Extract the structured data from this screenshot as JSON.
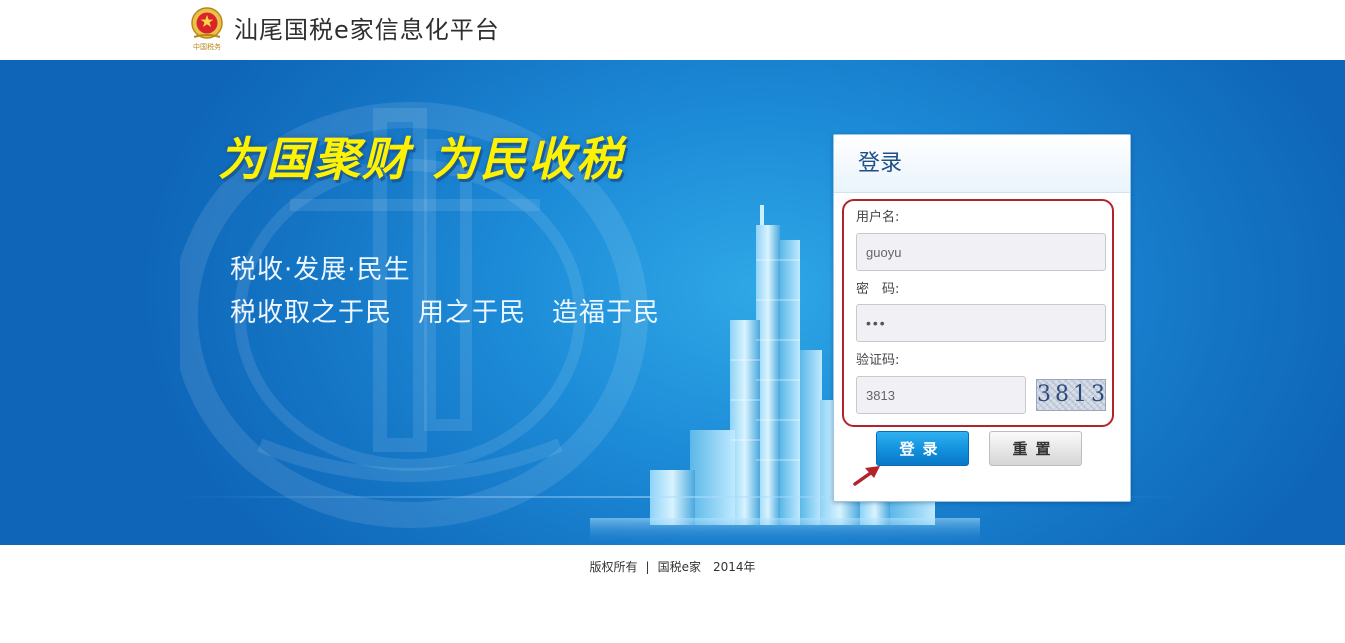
{
  "header": {
    "title": "汕尾国税e家信息化平台",
    "emblem_text": "中国税务"
  },
  "banner": {
    "slogan_left": "为国聚财",
    "slogan_right": "为民收税",
    "motto_line1": [
      "税收",
      "发展",
      "民生"
    ],
    "motto_separator": "·",
    "motto_line2": [
      "税收取之于民",
      "用之于民",
      "造福于民"
    ]
  },
  "login": {
    "title": "登录",
    "username_label": "用户名:",
    "username_value": "guoyu",
    "password_label": "密　码:",
    "password_value": "•••",
    "captcha_label": "验证码:",
    "captcha_value": "3813",
    "captcha_image_text": "3813",
    "login_button": "登录",
    "reset_button": "重置"
  },
  "footer": {
    "rights": "版权所有",
    "separator": "|",
    "brand": "国税e家",
    "year": "2014年"
  },
  "colors": {
    "banner_blue": "#1d8cd8",
    "slogan_yellow": "#fff200",
    "login_button_blue": "#1290dc",
    "highlight_red": "#b3232c"
  }
}
